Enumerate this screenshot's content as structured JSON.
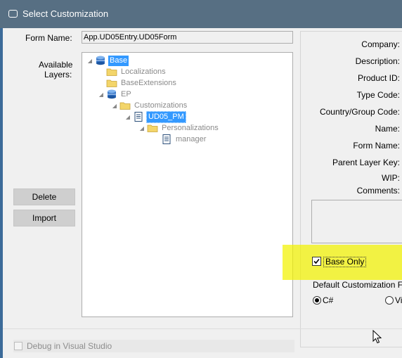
{
  "window": {
    "title": "Select Customization"
  },
  "form": {
    "form_name_label": "Form Name:",
    "form_name_value": "App.UD05Entry.UD05Form",
    "available_layers_label_line1": "Available",
    "available_layers_label_line2": "Layers:"
  },
  "tree": {
    "nodes": [
      {
        "label": "Base",
        "icon": "database-icon",
        "selected": true
      },
      {
        "label": "Localizations",
        "icon": "folder-icon"
      },
      {
        "label": "BaseExtensions",
        "icon": "folder-icon"
      },
      {
        "label": "EP",
        "icon": "database-icon"
      },
      {
        "label": "Customizations",
        "icon": "folder-icon"
      },
      {
        "label": "UD05_PM",
        "icon": "document-icon",
        "highlighted": true
      },
      {
        "label": "Personalizations",
        "icon": "folder-icon"
      },
      {
        "label": "manager",
        "icon": "document-icon"
      }
    ]
  },
  "buttons": {
    "delete_label": "Delete",
    "import_label": "Import"
  },
  "details": {
    "company": "Company:",
    "description": "Description:",
    "product_id": "Product ID:",
    "type_code": "Type Code:",
    "country_group_code": "Country/Group Code:",
    "name": "Name:",
    "form_name": "Form Name:",
    "parent_layer_key": "Parent Layer Key:",
    "wip": "WIP:",
    "comments": "Comments:"
  },
  "options": {
    "base_only_label": "Base Only",
    "base_only_checked": true,
    "default_customization_label": "Default Customization F",
    "radio_csharp_label": "C#",
    "radio_vb_label": "Vi",
    "radio_selected": "C#"
  },
  "footer": {
    "debug_label": "Debug in Visual Studio",
    "debug_checked": false
  },
  "colors": {
    "title_bar": "#576f83",
    "selection": "#3399ff",
    "highlight": "#f2f200"
  }
}
